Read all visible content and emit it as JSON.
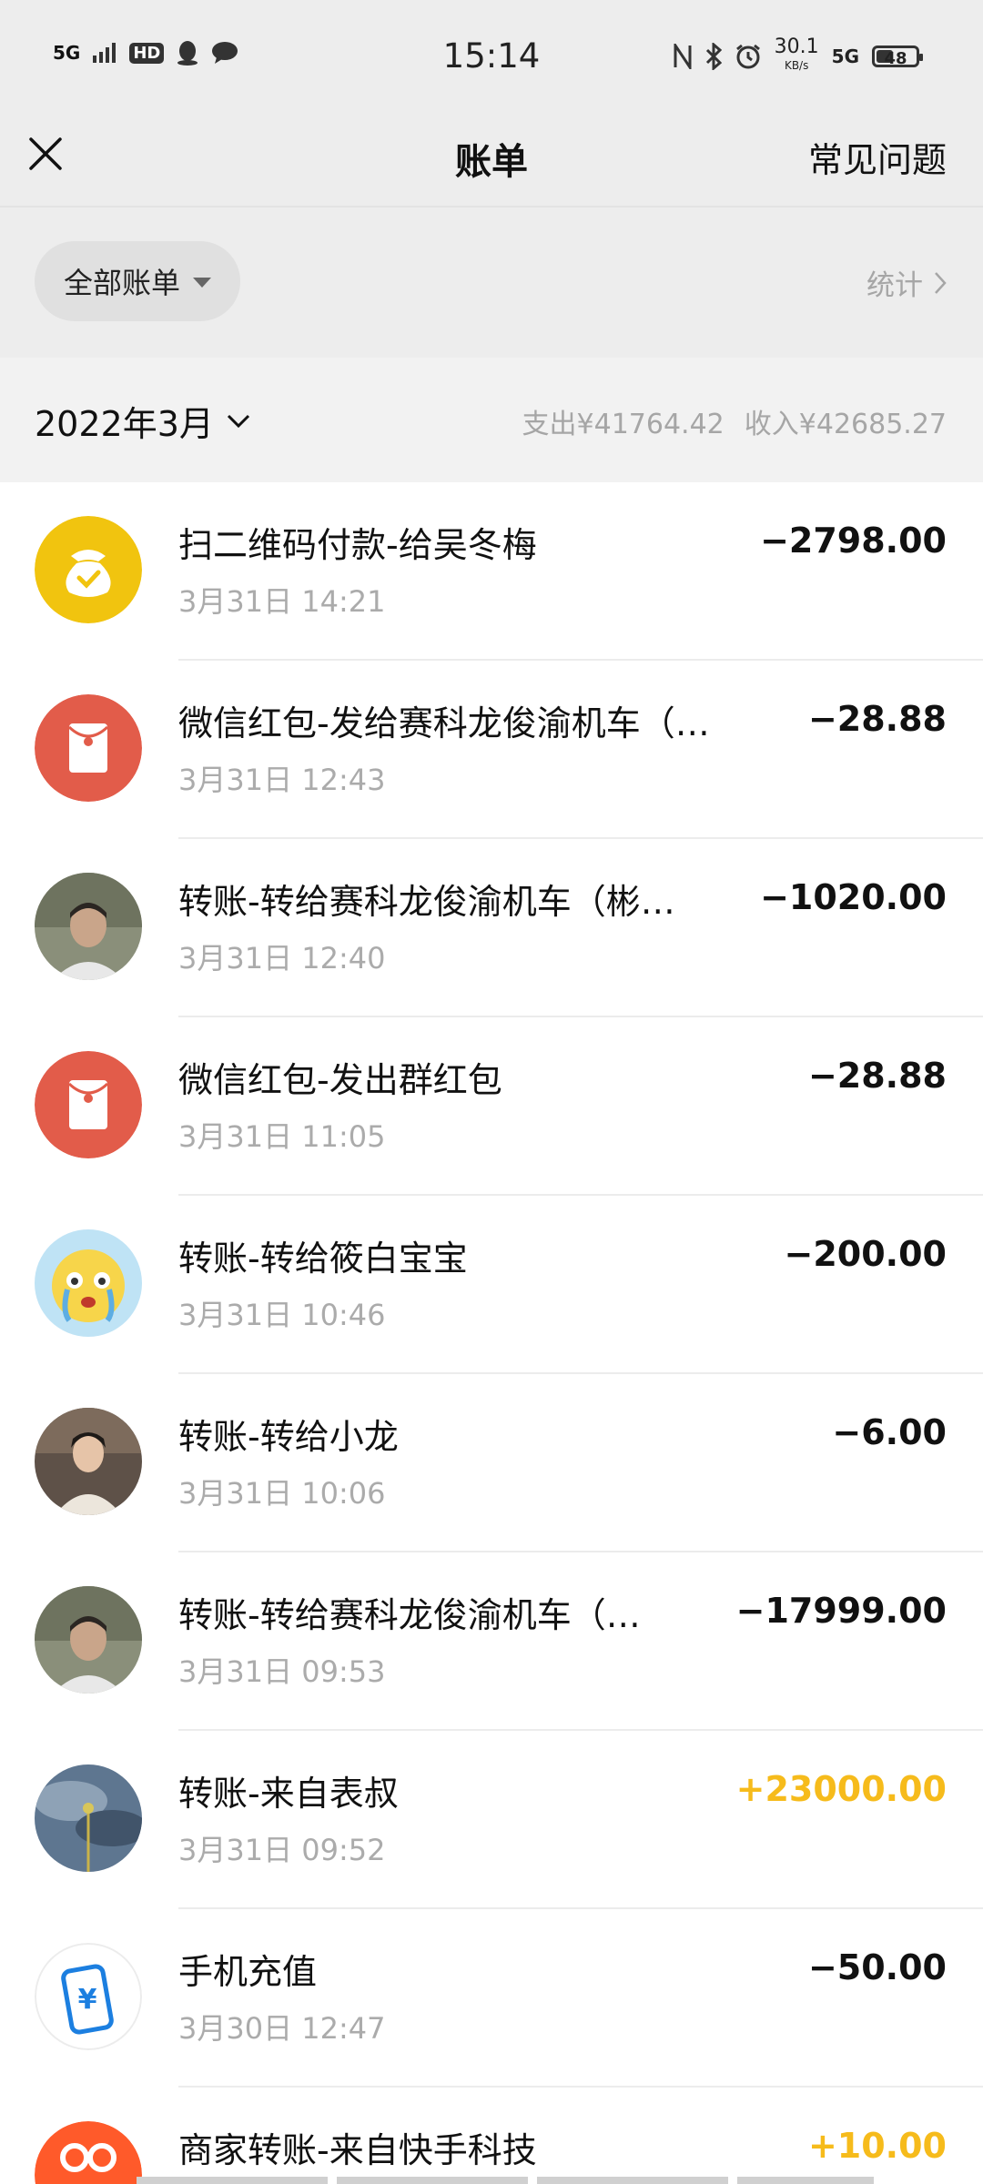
{
  "status_bar": {
    "left_network": "5G",
    "hd_label": "HD",
    "time": "15:14",
    "net_speed_value": "30.1",
    "net_speed_unit": "KB/s",
    "right_network": "5G",
    "battery": "48",
    "battery_level": 0.48
  },
  "nav": {
    "title": "账单",
    "faq": "常见问题"
  },
  "filter": {
    "label": "全部账单",
    "stats_label": "统计"
  },
  "month": {
    "label": "2022年3月",
    "expense": "支出¥41764.42",
    "income": "收入¥42685.27"
  },
  "transactions": [
    {
      "title": "扫二维码付款-给吴冬梅",
      "time": "3月31日 14:21",
      "amount": "−2798.00",
      "type": "expense",
      "icon": "money-bag-icon"
    },
    {
      "title": "微信红包-发给赛科龙俊渝机车（…",
      "time": "3月31日 12:43",
      "amount": "−28.88",
      "type": "expense",
      "icon": "red-packet-icon"
    },
    {
      "title": "转账-转给赛科龙俊渝机车（彬…",
      "time": "3月31日 12:40",
      "amount": "−1020.00",
      "type": "expense",
      "icon": "user-avatar"
    },
    {
      "title": "微信红包-发出群红包",
      "time": "3月31日 11:05",
      "amount": "−28.88",
      "type": "expense",
      "icon": "red-packet-icon"
    },
    {
      "title": "转账-转给筱白宝宝",
      "time": "3月31日 10:46",
      "amount": "−200.00",
      "type": "expense",
      "icon": "emoji-avatar"
    },
    {
      "title": "转账-转给小龙",
      "time": "3月31日 10:06",
      "amount": "−6.00",
      "type": "expense",
      "icon": "user-avatar"
    },
    {
      "title": "转账-转给赛科龙俊渝机车（…",
      "time": "3月31日 09:53",
      "amount": "−17999.00",
      "type": "expense",
      "icon": "user-avatar"
    },
    {
      "title": "转账-来自表叔",
      "time": "3月31日 09:52",
      "amount": "+23000.00",
      "type": "income",
      "icon": "sky-avatar"
    },
    {
      "title": "手机充值",
      "time": "3月30日 12:47",
      "amount": "−50.00",
      "type": "expense",
      "icon": "phone-recharge-icon"
    },
    {
      "title": "商家转账-来自快手科技",
      "time": "",
      "amount": "+10.00",
      "type": "income",
      "icon": "kuaishou-icon"
    }
  ],
  "colors": {
    "income": "#f6bb1b",
    "red_packet": "#e25c4a",
    "money_bag": "#f1c40f",
    "recharge_blue": "#1c7fe0"
  }
}
